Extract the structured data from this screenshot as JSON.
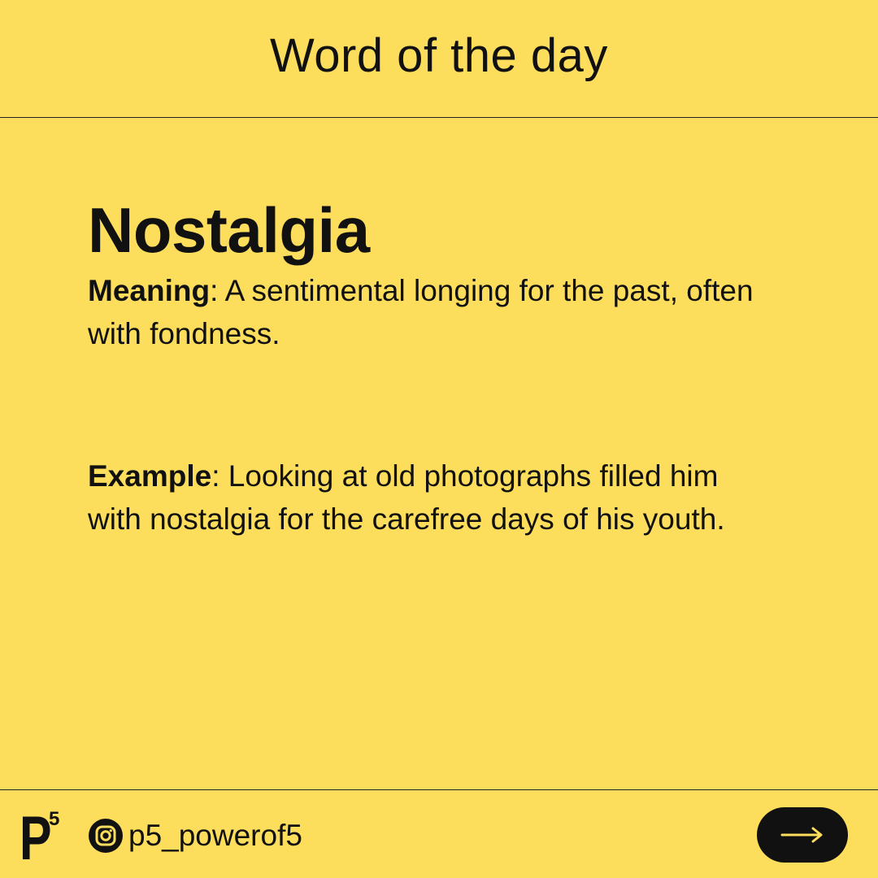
{
  "header": {
    "title": "Word of the day"
  },
  "word": {
    "title": "Nostalgia",
    "meaning_label": "Meaning",
    "meaning_text": ": A sentimental longing for the past, often with fondness.",
    "example_label": "Example",
    "example_text": ": Looking at old photographs filled him with nostalgia for the carefree days of his youth."
  },
  "footer": {
    "logo_letter": "P",
    "logo_superscript": "5",
    "handle": "p5_powerof5",
    "social_icon": "instagram-icon",
    "next_icon": "arrow-right-icon"
  },
  "colors": {
    "background": "#FDDD5C",
    "text": "#111111",
    "button": "#111111",
    "button_icon": "#FDDD5C"
  }
}
